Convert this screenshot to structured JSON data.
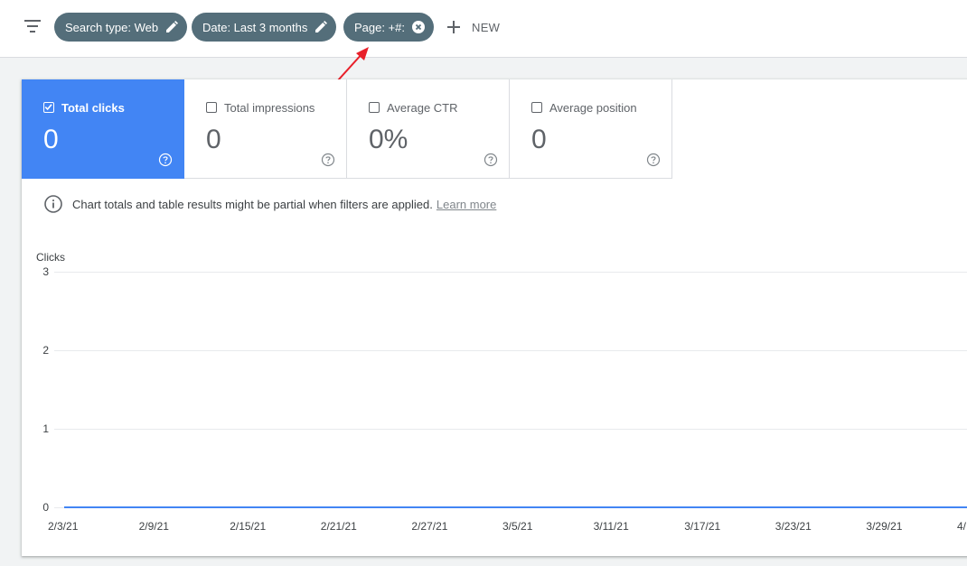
{
  "filters": {
    "chips": [
      {
        "label": "Search type: Web",
        "action_icon": "pencil-icon"
      },
      {
        "label": "Date: Last 3 months",
        "action_icon": "pencil-icon"
      },
      {
        "label": "Page: +#:",
        "action_icon": "close-circle-icon"
      }
    ],
    "new_label": "NEW"
  },
  "metrics": [
    {
      "label": "Total clicks",
      "value": "0",
      "checked": true
    },
    {
      "label": "Total impressions",
      "value": "0",
      "checked": false
    },
    {
      "label": "Average CTR",
      "value": "0%",
      "checked": false
    },
    {
      "label": "Average position",
      "value": "0",
      "checked": false
    }
  ],
  "notice": {
    "text": "Chart totals and table results might be partial when filters are applied.",
    "link": "Learn more"
  },
  "colors": {
    "accent": "#4285f4",
    "chip": "#546e7a",
    "annotation_arrow": "#e8202a"
  },
  "chart_data": {
    "type": "line",
    "ylabel": "Clicks",
    "ylim": [
      0,
      3
    ],
    "yticks": [
      "3",
      "2",
      "1",
      "0"
    ],
    "x": [
      "2/3/21",
      "2/9/21",
      "2/15/21",
      "2/21/21",
      "2/27/21",
      "3/5/21",
      "3/11/21",
      "3/17/21",
      "3/23/21",
      "3/29/21",
      "4/"
    ],
    "series": [
      {
        "values": [
          0,
          0,
          0,
          0,
          0,
          0,
          0,
          0,
          0,
          0,
          0
        ]
      }
    ]
  }
}
